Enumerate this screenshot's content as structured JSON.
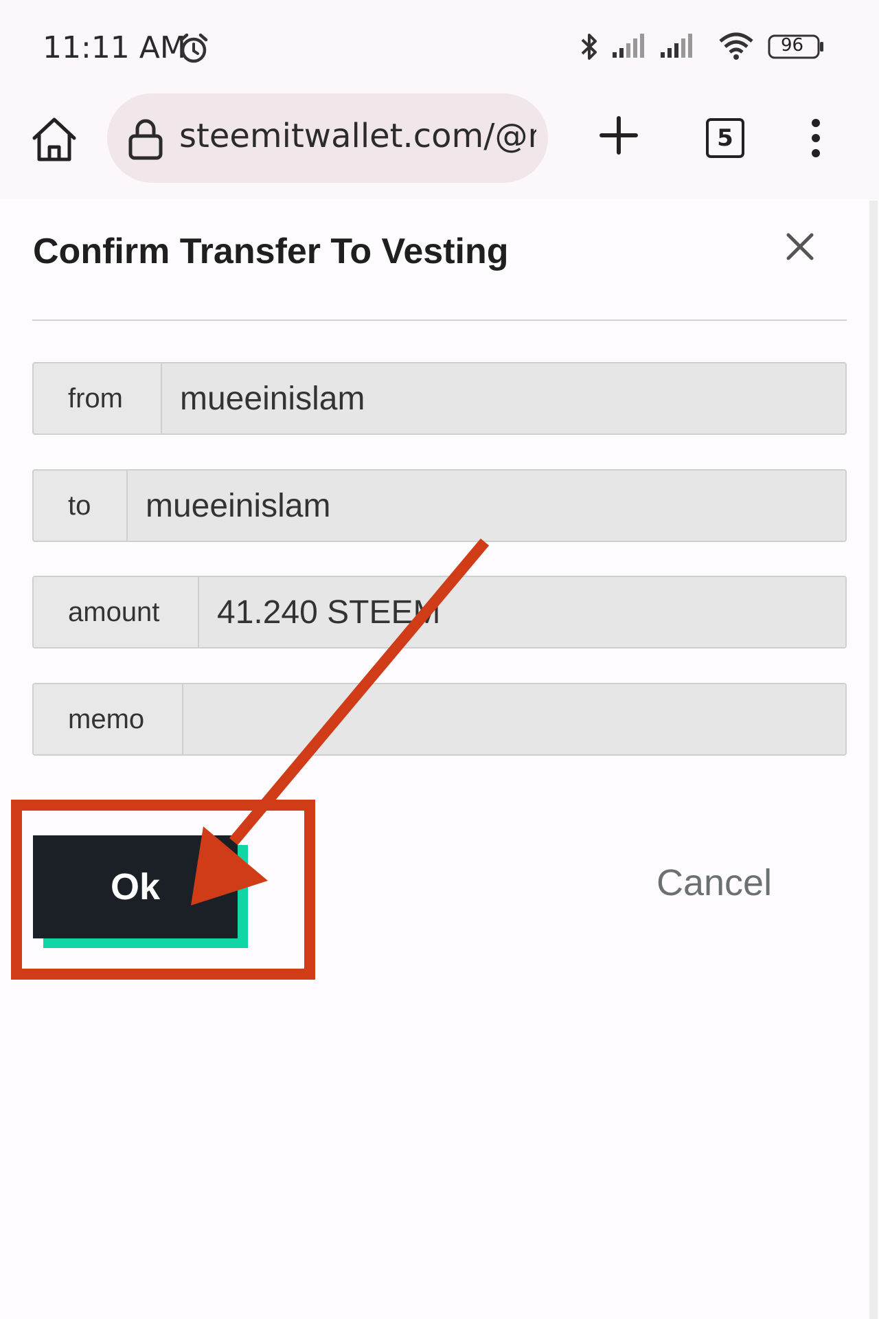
{
  "status_bar": {
    "time": "11:11 AM",
    "battery_level": "96",
    "icons": [
      "alarm-icon",
      "bluetooth-icon",
      "signal-icon",
      "signal-icon",
      "wifi-icon",
      "battery-icon"
    ]
  },
  "browser": {
    "url": "steemitwallet.com/@mu",
    "tab_count": "5",
    "icons": [
      "home-icon",
      "lock-icon",
      "plus-icon",
      "tabs-icon",
      "more-vert-icon"
    ]
  },
  "dialog": {
    "title": "Confirm Transfer To Vesting",
    "fields": [
      {
        "label": "from",
        "value": "mueeinislam"
      },
      {
        "label": "to",
        "value": "mueeinislam"
      },
      {
        "label": "amount",
        "value": "41.240 STEEM"
      },
      {
        "label": "memo",
        "value": ""
      }
    ],
    "ok_label": "Ok",
    "cancel_label": "Cancel"
  },
  "colors": {
    "annotation_red": "#d03c18",
    "ok_button": "#1b2026",
    "ok_shadow": "#0fd6a4"
  }
}
